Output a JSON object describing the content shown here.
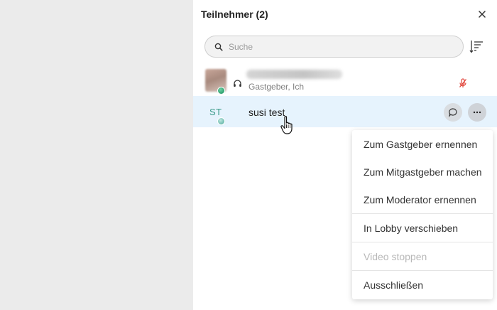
{
  "panel": {
    "title": "Teilnehmer (2)",
    "close_icon": "close-icon"
  },
  "search": {
    "placeholder": "Suche",
    "value": "",
    "icon": "search-icon"
  },
  "sort": {
    "icon": "sort-list-icon"
  },
  "participants": [
    {
      "name": "",
      "subtitle": "Gastgeber, Ich",
      "avatar": "photo",
      "status_color": "#138a57",
      "audio_icon": "headset-icon",
      "mic_icon": "mic-off-icon",
      "mic_icon_color": "#e0443a"
    },
    {
      "initials": "ST",
      "name": "susi test",
      "status_color": "#4aa79a",
      "chat_icon": "chat-bubble-icon",
      "more_icon": "more-dots-icon",
      "highlighted": true
    }
  ],
  "menu": {
    "items": [
      {
        "label": "Zum Gastgeber ernennen",
        "enabled": true
      },
      {
        "label": "Zum Mitgastgeber machen",
        "enabled": true
      },
      {
        "label": "Zum Moderator ernennen",
        "enabled": true
      },
      {
        "label": "In Lobby verschieben",
        "enabled": true
      },
      {
        "label": "Video stoppen",
        "enabled": false
      },
      {
        "label": "Ausschließen",
        "enabled": true
      }
    ]
  },
  "colors": {
    "row_highlight": "#e6f3fd",
    "initials": "#3a9a8a",
    "left_background": "#ebebeb"
  }
}
